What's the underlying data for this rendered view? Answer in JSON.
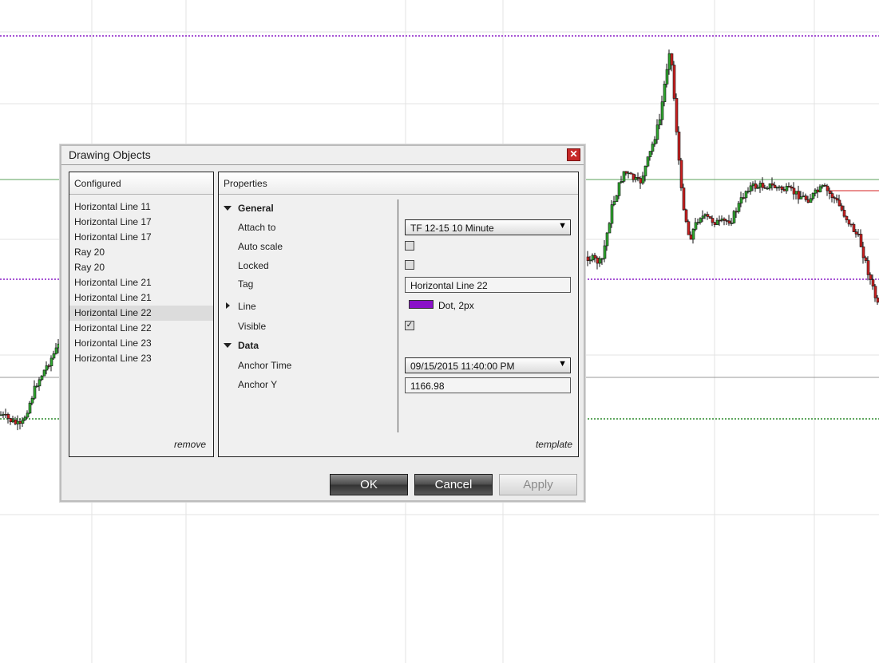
{
  "colors": {
    "purple_line": "#8a1cc7",
    "green_line": "#2c8a2c",
    "red_line": "#d42222",
    "gray_line": "#777777",
    "grid": "#e3e3e3"
  },
  "dialog": {
    "title": "Drawing Objects",
    "close_icon": "close-icon",
    "configured": {
      "header": "Configured",
      "items": [
        "Horizontal Line 11",
        "Horizontal Line 17",
        "Horizontal Line 17",
        "Ray 20",
        "Ray 20",
        "Horizontal Line 21",
        "Horizontal Line 21",
        "Horizontal Line 22",
        "Horizontal Line 22",
        "Horizontal Line 23",
        "Horizontal Line 23"
      ],
      "selected_index": 7,
      "remove_link": "remove"
    },
    "properties": {
      "header": "Properties",
      "general_label": "General",
      "attach_to_label": "Attach to",
      "attach_to_value": "TF 12-15 10 Minute",
      "auto_scale_label": "Auto scale",
      "auto_scale_checked": false,
      "locked_label": "Locked",
      "locked_checked": false,
      "tag_label": "Tag",
      "tag_value": "Horizontal Line 22",
      "line_label": "Line",
      "line_color": "#8a10c8",
      "line_style_value": "Dot, 2px",
      "visible_label": "Visible",
      "visible_checked": true,
      "data_label": "Data",
      "anchor_time_label": "Anchor Time",
      "anchor_time_value": "09/15/2015 11:40:00 PM",
      "anchor_y_label": "Anchor Y",
      "anchor_y_value": "1166.98",
      "template_link": "template"
    },
    "buttons": {
      "ok": "OK",
      "cancel": "Cancel",
      "apply": "Apply"
    }
  }
}
